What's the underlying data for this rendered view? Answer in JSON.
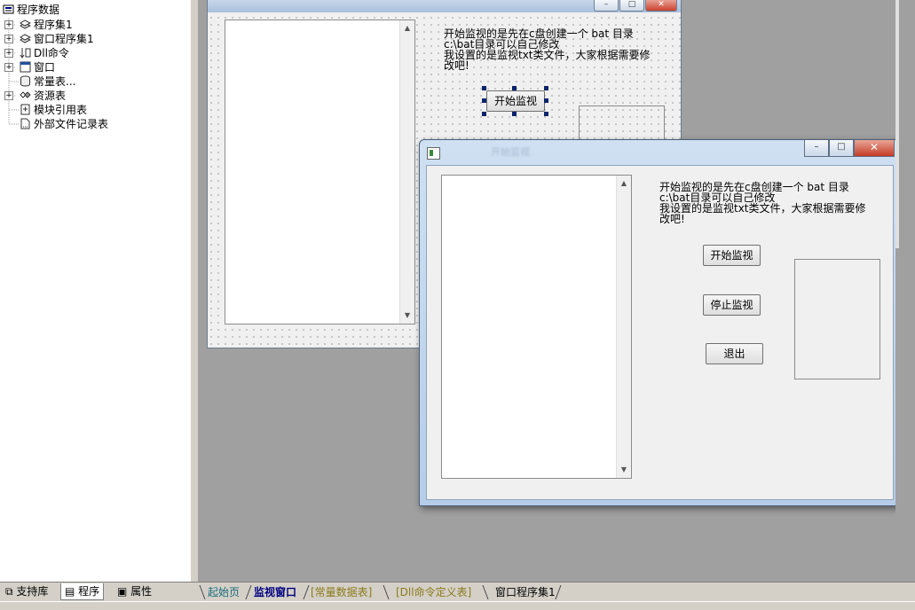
{
  "tree": {
    "root": "程序数据",
    "items": [
      {
        "label": "程序集1",
        "expandable": true
      },
      {
        "label": "窗口程序集1",
        "expandable": true
      },
      {
        "label": "Dll命令",
        "expandable": true
      },
      {
        "label": "窗口",
        "expandable": true
      },
      {
        "label": "常量表...",
        "expandable": false
      },
      {
        "label": "资源表",
        "expandable": true
      },
      {
        "label": "模块引用表",
        "expandable": false
      },
      {
        "label": "外部文件记录表",
        "expandable": false
      }
    ]
  },
  "left_tabs": {
    "support": "支持库",
    "program": "程序",
    "properties": "属性"
  },
  "doc_tabs": [
    {
      "label": "起始页",
      "color": "#1a6b7a"
    },
    {
      "label": "监视窗口",
      "color": "#000080"
    },
    {
      "label": "[常量数据表]",
      "color": "#8a7a1a"
    },
    {
      "label": "[Dll命令定义表]",
      "color": "#8a7a1a"
    },
    {
      "label": "窗口程序集1",
      "color": "#000000"
    }
  ],
  "designer": {
    "info_lines": [
      "开始监视的是先在c盘创建一个 bat 目录",
      "c:\\bat目录可以自己修改",
      "我设置的是监视txt类文件，大家根据需要修",
      "改吧!"
    ],
    "start_button": "开始监视",
    "titlebar_buttons": [
      "–",
      "□",
      "✕"
    ]
  },
  "runtime": {
    "info_lines": [
      "开始监视的是先在c盘创建一个 bat 目录",
      "c:\\bat目录可以自己修改",
      "我设置的是监视txt类文件，大家根据需要修",
      "改吧!"
    ],
    "start_button": "开始监视",
    "stop_button": "停止监视",
    "exit_button": "退出",
    "titlebar_buttons": [
      "–",
      "□",
      "✕"
    ],
    "blurred_title": "开始监视"
  }
}
